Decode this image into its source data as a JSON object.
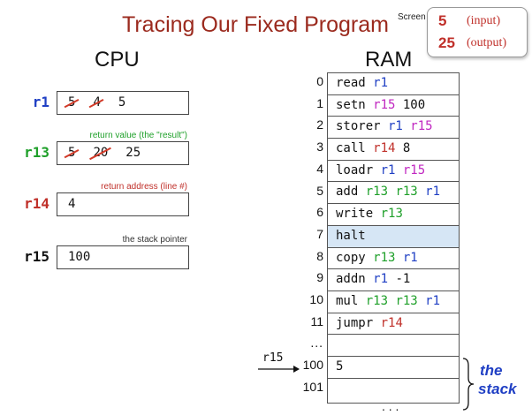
{
  "title": "Tracing Our Fixed Program",
  "screen": {
    "label": "Screen",
    "input_value": "5",
    "input_note": "(input)",
    "output_value": "25",
    "output_note": "(output)"
  },
  "cpu": {
    "heading": "CPU",
    "registers": [
      {
        "name": "r1",
        "color": "#1f3fc4",
        "struck": [
          "5",
          "4"
        ],
        "value": "5",
        "note": ""
      },
      {
        "name": "r13",
        "color": "#1fa02a",
        "struck": [
          "5",
          "20"
        ],
        "value": "25",
        "note": "return value (the \"result\")",
        "note_color": "#1fa02a"
      },
      {
        "name": "r14",
        "color": "#c0302a",
        "struck": [],
        "value": "4",
        "note": "return address (line #)",
        "note_color": "#c0302a"
      },
      {
        "name": "r15",
        "color": "#111111",
        "struck": [],
        "value": "100",
        "note": "the stack pointer",
        "note_color": "#333333"
      }
    ]
  },
  "ram": {
    "heading": "RAM",
    "rows": [
      {
        "index": "0",
        "tokens": [
          [
            "read",
            "black"
          ],
          [
            "r1",
            "blue"
          ]
        ]
      },
      {
        "index": "1",
        "tokens": [
          [
            "setn",
            "black"
          ],
          [
            "r15",
            "pink"
          ],
          [
            "100",
            "black"
          ]
        ]
      },
      {
        "index": "2",
        "tokens": [
          [
            "storer",
            "black"
          ],
          [
            "r1",
            "blue"
          ],
          [
            "r15",
            "pink"
          ]
        ]
      },
      {
        "index": "3",
        "tokens": [
          [
            "call",
            "black"
          ],
          [
            "r14",
            "red"
          ],
          [
            "8",
            "black"
          ]
        ]
      },
      {
        "index": "4",
        "tokens": [
          [
            "loadr",
            "black"
          ],
          [
            "r1",
            "blue"
          ],
          [
            "r15",
            "pink"
          ]
        ]
      },
      {
        "index": "5",
        "tokens": [
          [
            "add",
            "black"
          ],
          [
            "r13",
            "green"
          ],
          [
            "r13",
            "green"
          ],
          [
            "r1",
            "blue"
          ]
        ]
      },
      {
        "index": "6",
        "tokens": [
          [
            "write",
            "black"
          ],
          [
            "r13",
            "green"
          ]
        ]
      },
      {
        "index": "7",
        "tokens": [
          [
            "halt",
            "black"
          ]
        ],
        "highlight": true
      },
      {
        "index": "8",
        "tokens": [
          [
            "copy",
            "black"
          ],
          [
            "r13",
            "green"
          ],
          [
            "r1",
            "blue"
          ]
        ]
      },
      {
        "index": "9",
        "tokens": [
          [
            "addn",
            "black"
          ],
          [
            "r1",
            "blue"
          ],
          [
            "-1",
            "black"
          ]
        ]
      },
      {
        "index": "10",
        "tokens": [
          [
            "mul",
            "black"
          ],
          [
            "r13",
            "green"
          ],
          [
            "r13",
            "green"
          ],
          [
            "r1",
            "blue"
          ]
        ]
      },
      {
        "index": "11",
        "tokens": [
          [
            "jumpr",
            "black"
          ],
          [
            "r14",
            "red"
          ]
        ]
      },
      {
        "index": "...",
        "tokens": []
      },
      {
        "index": "100",
        "tokens": [
          [
            "5",
            "black"
          ]
        ]
      },
      {
        "index": "101",
        "tokens": []
      }
    ],
    "bottom_ellipsis": ". . .",
    "pointer_label": "r15",
    "stack_label_line1": "the",
    "stack_label_line2": "stack"
  }
}
